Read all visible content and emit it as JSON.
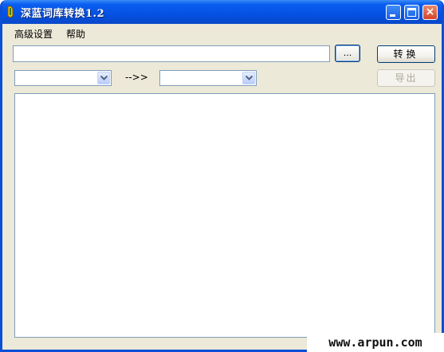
{
  "window": {
    "title": "深蓝词库转换1.2",
    "controls": {
      "minimize_icon": "minimize-icon",
      "maximize_icon": "maximize-icon",
      "close_icon": "close-icon",
      "close_glyph": "×"
    },
    "accent_color": "#0a5ef0"
  },
  "menu": {
    "items": [
      {
        "label": "高级设置"
      },
      {
        "label": "帮助"
      }
    ]
  },
  "file": {
    "path_value": "",
    "browse_label": "...",
    "convert_label": "转换"
  },
  "formats": {
    "source_selected": "",
    "arrow_text": "-->>",
    "target_selected": "",
    "export_label": "导出",
    "export_enabled": false
  },
  "output": {
    "log_text": ""
  },
  "watermark": {
    "text": "www.arpun.com"
  }
}
